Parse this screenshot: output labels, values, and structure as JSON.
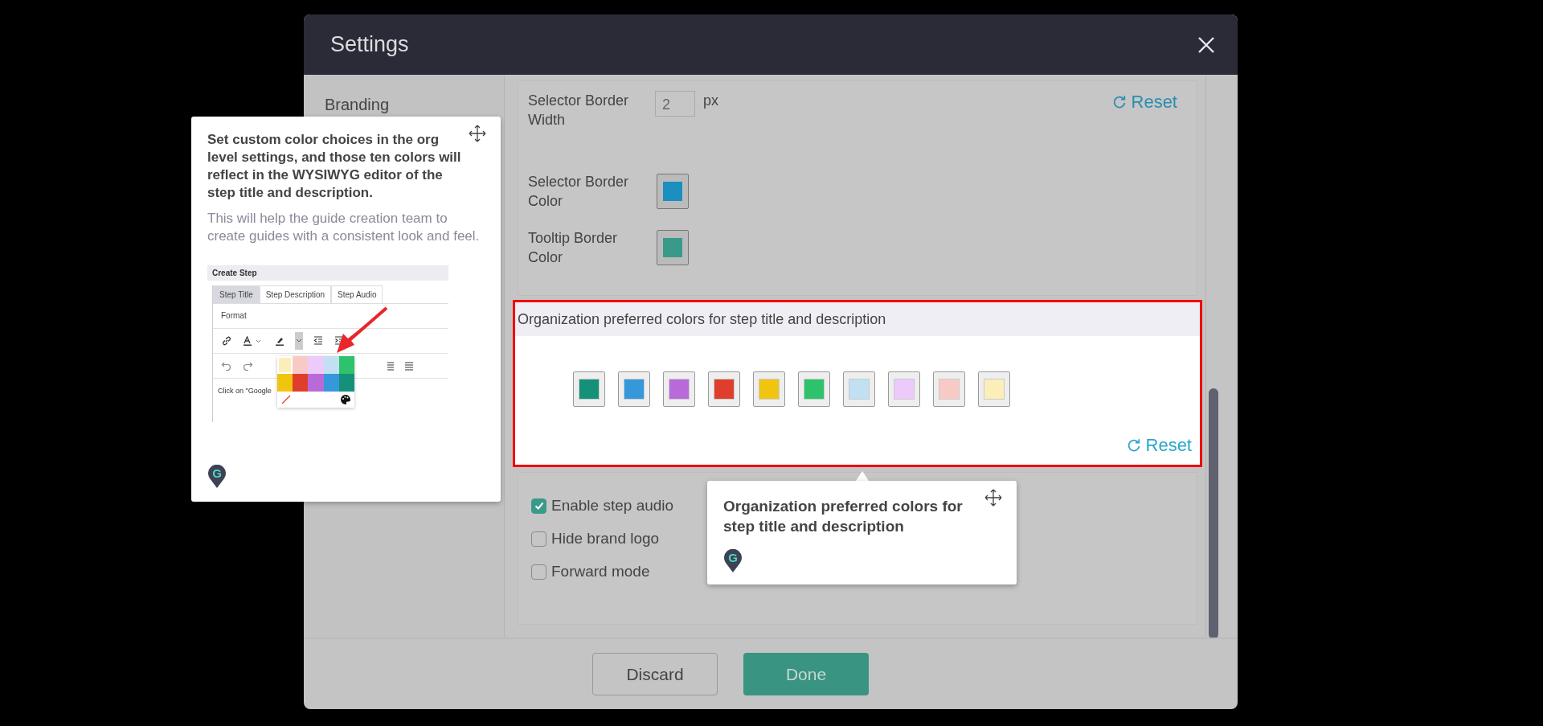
{
  "window": {
    "title": "Settings"
  },
  "sidebar": {
    "items": [
      {
        "label": "Branding"
      }
    ]
  },
  "border_settings": {
    "reset": "Reset",
    "rows": [
      {
        "kind": "number",
        "label": "Selector Border Width",
        "value": "2",
        "unit": "px"
      },
      {
        "kind": "color",
        "label": "Selector Border Color",
        "color": "#1a8fc0"
      },
      {
        "kind": "color",
        "label": "Tooltip Border Color",
        "color": "#3a9a8a"
      }
    ]
  },
  "preferred_colors": {
    "title": "Organization preferred colors for step title and description",
    "reset": "Reset",
    "swatches": [
      {
        "color": "#169179"
      },
      {
        "color": "#3598db"
      },
      {
        "color": "#b96ad9"
      },
      {
        "color": "#e03e2d"
      },
      {
        "color": "#f1c40f"
      },
      {
        "color": "#2dc26b"
      },
      {
        "color": "#c2e0f4"
      },
      {
        "color": "#eccafa"
      },
      {
        "color": "#f8cac6"
      },
      {
        "color": "#fbeeb8"
      }
    ]
  },
  "options": [
    {
      "label": "Enable step audio",
      "checked": true
    },
    {
      "label": "Hide brand logo",
      "checked": false
    },
    {
      "label": "Forward mode",
      "checked": false
    }
  ],
  "buttons": [
    {
      "label": "Discard",
      "kind": "secondary"
    },
    {
      "label": "Done",
      "kind": "primary"
    }
  ],
  "guide_tooltips": [
    {
      "title": "Set custom color choices in the org level settings, and those ten colors will reflect in the WYSIWYG editor of the step title and description.",
      "body": "This will help the guide creation team to create guides with a consistent look and feel.",
      "logo_letter": "G",
      "preview": {
        "title": "Create Step",
        "tabs": [
          {
            "label": "Step Title",
            "selected": true
          },
          {
            "label": "Step Description",
            "selected": false
          },
          {
            "label": "Step Audio",
            "selected": false
          }
        ],
        "format_label": "Format",
        "text": "Click on \"Google",
        "palette": [
          {
            "color": "#fbeeb8"
          },
          {
            "color": "#f8cac6"
          },
          {
            "color": "#eccafa"
          },
          {
            "color": "#c2e0f4"
          },
          {
            "color": "#2dc26b"
          },
          {
            "color": "#f1c40f"
          },
          {
            "color": "#e03e2d"
          },
          {
            "color": "#b96ad9"
          },
          {
            "color": "#3598db"
          },
          {
            "color": "#169179"
          }
        ]
      }
    },
    {
      "title": "Organization preferred colors for step title and description",
      "logo_letter": "G"
    }
  ]
}
